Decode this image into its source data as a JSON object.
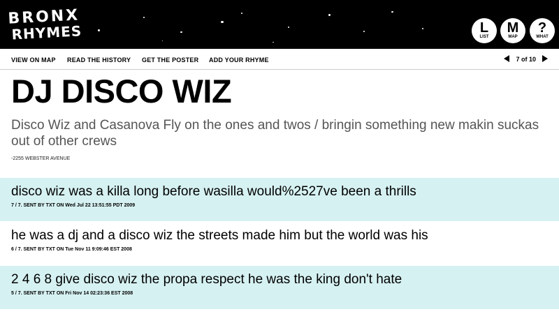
{
  "header": {
    "logo_line1": "BRONX",
    "logo_line2": "RHYMES",
    "buttons": [
      {
        "letter": "L",
        "label": "LIST"
      },
      {
        "letter": "M",
        "label": "MAP"
      },
      {
        "letter": "?",
        "label": "WHAT"
      }
    ],
    "background_color": "#000000"
  },
  "nav": {
    "links": [
      "VIEW ON MAP",
      "READ THE HISTORY",
      "GET THE POSTER",
      "ADD YOUR RHYME"
    ],
    "pager_text": "7 of 10"
  },
  "page": {
    "title": "DJ DISCO WIZ",
    "subtitle": "Disco Wiz and Casanova Fly on the ones and twos / bringin something new makin suckas out of other crews",
    "address": "-2255 WEBSTER AVENUE"
  },
  "rhymes": [
    {
      "text": "disco wiz was a killa long before wasilla would%2527ve been a thrills",
      "meta": "7 / 7. SENT BY TXT ON Wed Jul 22 13:51:55 PDT 2009"
    },
    {
      "text": "he was a dj and a disco wiz the streets made him but the world was his",
      "meta": "6 / 7. SENT BY TXT ON Tue Nov 11 9:09:46 EST 2008"
    },
    {
      "text": "2 4 6 8 give disco wiz the propa respect he was the king don't hate",
      "meta": "5 / 7. SENT BY TXT ON Fri Nov 14 02:23:36 EST 2008"
    }
  ],
  "colors": {
    "alt_row": "#d6f1f2",
    "subtitle": "#555555"
  }
}
